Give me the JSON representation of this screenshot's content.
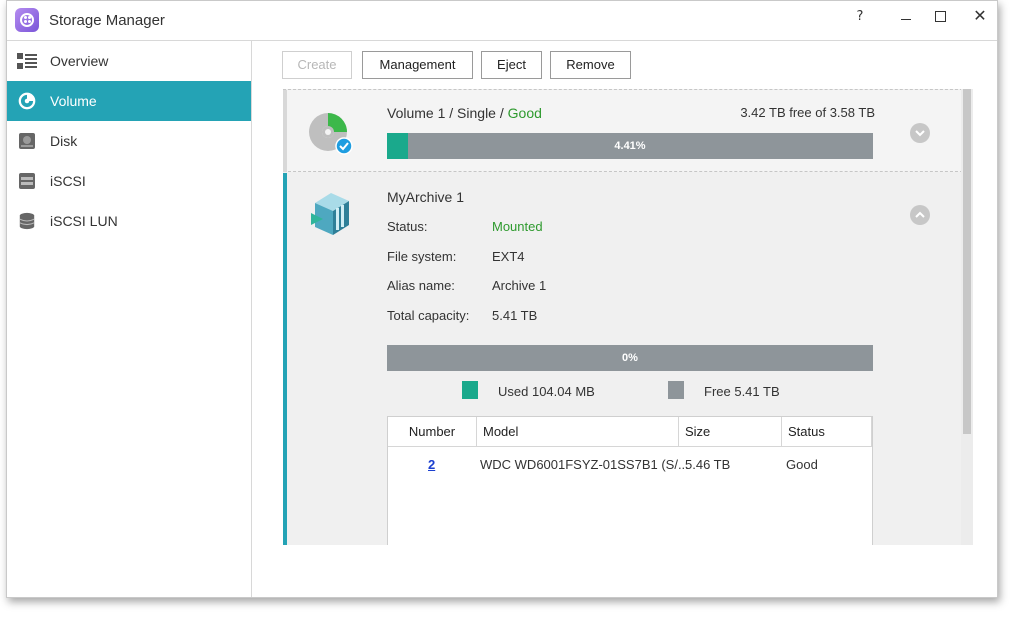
{
  "window": {
    "title": "Storage Manager",
    "help_label": "?",
    "close_label": "✕"
  },
  "sidebar": {
    "items": [
      {
        "label": "Overview",
        "icon": "overview-icon"
      },
      {
        "label": "Volume",
        "icon": "volume-icon"
      },
      {
        "label": "Disk",
        "icon": "disk-icon"
      },
      {
        "label": "iSCSI",
        "icon": "iscsi-icon"
      },
      {
        "label": "iSCSI LUN",
        "icon": "iscsi-lun-icon"
      }
    ],
    "active_index": 1
  },
  "toolbar": {
    "create": "Create",
    "management": "Management",
    "eject": "Eject",
    "remove": "Remove"
  },
  "volume1": {
    "name": "Volume 1",
    "sep1": " / ",
    "type": "Single",
    "sep2": " / ",
    "status": "Good",
    "free_text": "3.42 TB free of 3.58 TB",
    "usage_label": "4.41%",
    "usage_fraction": 0.0441
  },
  "archive": {
    "title": "MyArchive 1",
    "status_label": "Status:",
    "status_value": "Mounted",
    "fs_label": "File system:",
    "fs_value": "EXT4",
    "alias_label": "Alias name:",
    "alias_value": "Archive 1",
    "capacity_label": "Total capacity:",
    "capacity_value": "5.41 TB",
    "usage_label": "0%",
    "usage_fraction": 0,
    "legend": {
      "used": "Used 104.04 MB",
      "free": "Free 5.41 TB"
    }
  },
  "disk_table": {
    "headers": [
      "Number",
      "Model",
      "Size",
      "Status"
    ],
    "rows": [
      {
        "number": "2",
        "model": "WDC WD6001FSYZ-01SS7B1 (S/...",
        "size": "5.46 TB",
        "status": "Good"
      }
    ]
  },
  "colors": {
    "accent": "#24a3b5",
    "used": "#1aa98c",
    "free": "#8e959a",
    "good": "#2e9a2e",
    "link": "#1b3fcf"
  }
}
